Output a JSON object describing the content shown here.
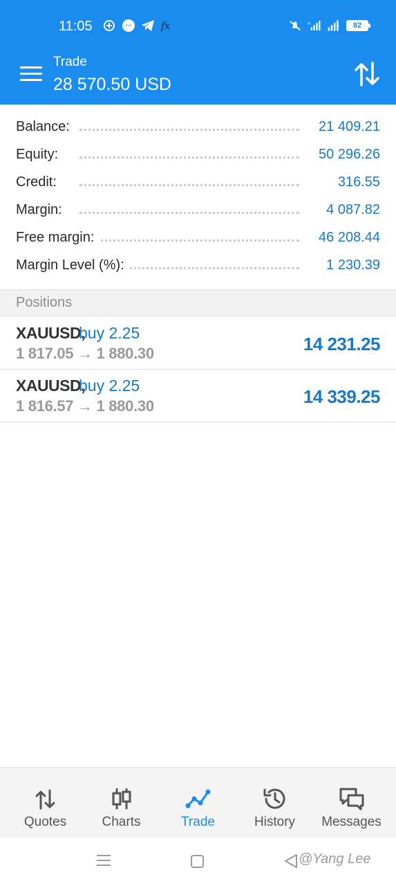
{
  "status_bar": {
    "time": "11:05",
    "battery": "82",
    "left_icons": [
      "notification-icon",
      "messenger-icon",
      "telegram-icon",
      "fx-icon"
    ],
    "right_icons": [
      "mute-icon",
      "signal-icon",
      "signal-icon",
      "battery-icon"
    ]
  },
  "header": {
    "subtitle": "Trade",
    "title": "28 570.50 USD"
  },
  "summary": [
    {
      "label": "Balance:",
      "value": "21 409.21"
    },
    {
      "label": "Equity:",
      "value": "50 296.26"
    },
    {
      "label": "Credit:",
      "value": "316.55"
    },
    {
      "label": "Margin:",
      "value": "4 087.82"
    },
    {
      "label": "Free margin:",
      "value": "46 208.44"
    },
    {
      "label": "Margin Level (%):",
      "value": "1 230.39"
    }
  ],
  "positions_header": "Positions",
  "positions": [
    {
      "symbol": "XAUUSD,",
      "side": "buy 2.25",
      "prices": "1 817.05 → 1 880.30",
      "profit": "14 231.25"
    },
    {
      "symbol": "XAUUSD,",
      "side": "buy 2.25",
      "prices": "1 816.57 → 1 880.30",
      "profit": "14 339.25"
    }
  ],
  "tabs": [
    {
      "label": "Quotes",
      "icon": "quotes-icon",
      "active": false
    },
    {
      "label": "Charts",
      "icon": "charts-icon",
      "active": false
    },
    {
      "label": "Trade",
      "icon": "trade-icon",
      "active": true
    },
    {
      "label": "History",
      "icon": "history-icon",
      "active": false
    },
    {
      "label": "Messages",
      "icon": "messages-icon",
      "active": false
    }
  ],
  "watermark": "@Yang Lee",
  "colors": {
    "header_bg": "#1a8cf0",
    "value_blue": "#1779c9",
    "active_tab": "#1a8cf0"
  }
}
